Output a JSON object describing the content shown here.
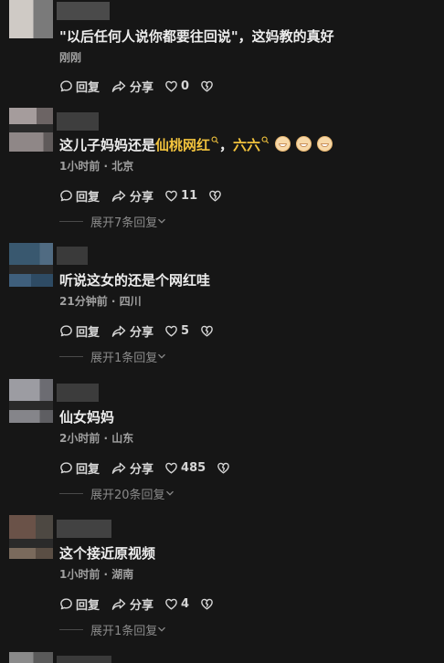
{
  "comments": [
    {
      "text": "\"以后任何人说你都要往回说\"，这妈教的真好",
      "meta": "刚刚",
      "reply": "回复",
      "share": "分享",
      "likes": "0",
      "expand": ""
    },
    {
      "text_prefix": "这儿子妈妈还是",
      "link1": "仙桃网红",
      "sep": "，",
      "link2": "六六",
      "meta": "1小时前 · 北京",
      "reply": "回复",
      "share": "分享",
      "likes": "11",
      "expand": "展开7条回复"
    },
    {
      "text": "听说这女的还是个网红哇",
      "meta": "21分钟前 · 四川",
      "reply": "回复",
      "share": "分享",
      "likes": "5",
      "expand": "展开1条回复"
    },
    {
      "text": "仙女妈妈",
      "meta": "2小时前 · 山东",
      "reply": "回复",
      "share": "分享",
      "likes": "485",
      "expand": "展开20条回复"
    },
    {
      "text": "这个接近原视频",
      "meta": "1小时前 · 湖南",
      "reply": "回复",
      "share": "分享",
      "likes": "4",
      "expand": "展开1条回复"
    }
  ],
  "icons": {
    "reply": "comment-bubble-icon",
    "share": "share-arrow-icon",
    "like": "heart-icon",
    "dislike": "broken-heart-icon",
    "expand": "chevron-down-icon",
    "search": "search-icon"
  },
  "colors": {
    "background": "#161616",
    "highlight": "#f2c33d",
    "meta": "#a0a0a0"
  }
}
